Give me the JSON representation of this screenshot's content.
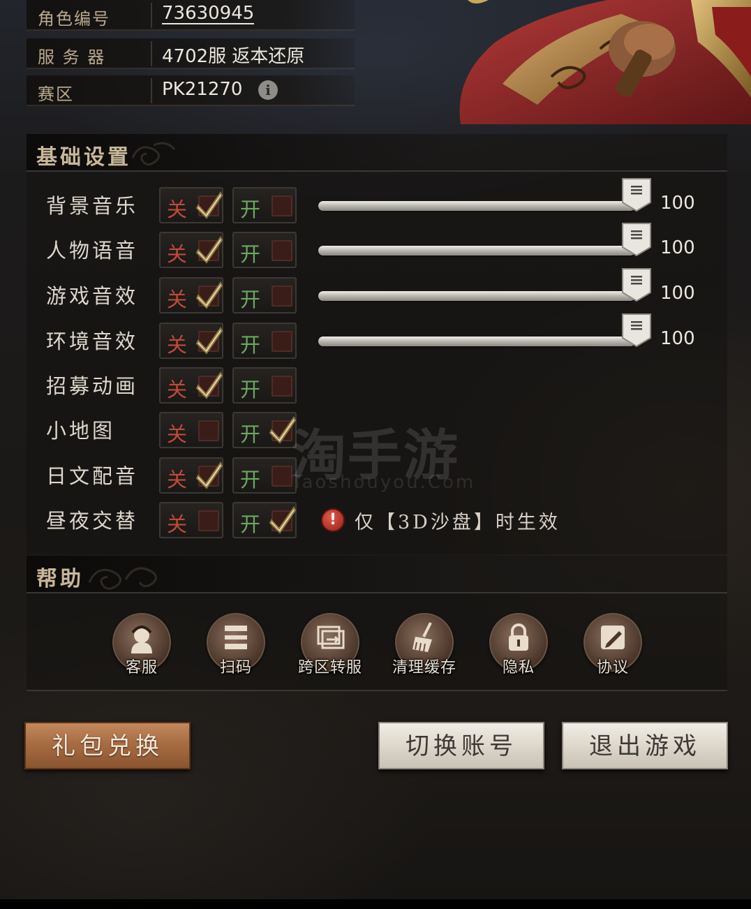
{
  "profile": {
    "role_id_label": "角色编号",
    "role_id": "73630945",
    "server_label": "服 务 器",
    "server": "4702服 返本还原",
    "zone_label": "赛区",
    "zone": "PK21270",
    "info_icon": "i"
  },
  "basic_settings": {
    "title": "基础设置",
    "off_label": "关",
    "on_label": "开",
    "rows": [
      {
        "label": "背景音乐",
        "state": "off",
        "slider": 100,
        "value": "100"
      },
      {
        "label": "人物语音",
        "state": "off",
        "slider": 100,
        "value": "100"
      },
      {
        "label": "游戏音效",
        "state": "off",
        "slider": 100,
        "value": "100"
      },
      {
        "label": "环境音效",
        "state": "off",
        "slider": 100,
        "value": "100"
      },
      {
        "label": "招募动画",
        "state": "off"
      },
      {
        "label": "小地图",
        "state": "on"
      },
      {
        "label": "日文配音",
        "state": "off"
      },
      {
        "label": "昼夜交替",
        "state": "on"
      }
    ],
    "note_icon": "!",
    "note": "仅【3D沙盘】时生效"
  },
  "help": {
    "title": "帮助",
    "items": [
      {
        "label": "客服",
        "icon": "customer-service-icon"
      },
      {
        "label": "扫码",
        "icon": "scan-icon"
      },
      {
        "label": "跨区转服",
        "icon": "server-transfer-icon"
      },
      {
        "label": "清理缓存",
        "icon": "broom-icon"
      },
      {
        "label": "隐私",
        "icon": "lock-icon"
      },
      {
        "label": "协议",
        "icon": "pen-icon"
      }
    ]
  },
  "actions": {
    "gift_redeem": "礼包兑换",
    "switch_account": "切换账号",
    "exit_game": "退出游戏"
  },
  "watermark": {
    "main": "淘手游",
    "sub": "Taoshouyou.Com"
  },
  "colors": {
    "off_text": "#c04a3a",
    "on_text": "#6aa861",
    "gift_button": "#a86c43",
    "light_button": "#ddd7cc"
  }
}
